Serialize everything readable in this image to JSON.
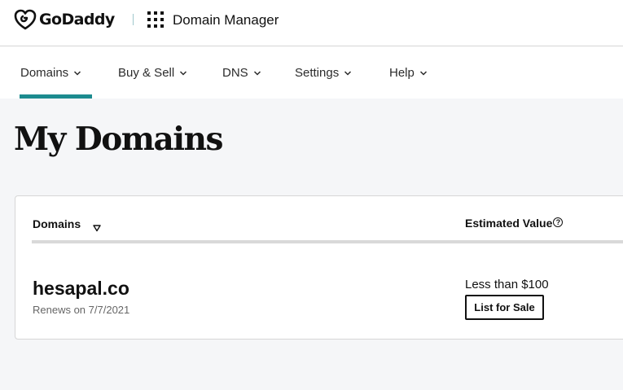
{
  "header": {
    "logo_text": "GoDaddy",
    "logo_icon": "godaddy-heart-icon",
    "apps_icon": "grid-icon",
    "app_title": "Domain Manager"
  },
  "nav": {
    "items": [
      {
        "label": "Domains",
        "active": true
      },
      {
        "label": "Buy & Sell",
        "active": false
      },
      {
        "label": "DNS",
        "active": false
      },
      {
        "label": "Settings",
        "active": false
      },
      {
        "label": "Help",
        "active": false
      }
    ],
    "accent_color": "#1c8b8f"
  },
  "main": {
    "title": "My Domains"
  },
  "table": {
    "columns": [
      {
        "label": "Domains",
        "sort_icon": "sort-down-icon"
      },
      {
        "label": "Estimated Value",
        "info_icon": "help-circle-icon"
      }
    ],
    "rows": [
      {
        "domain": "hesapal.co",
        "renews": "Renews on 7/7/2021",
        "estimated_value": "Less than $100",
        "action_label": "List for Sale"
      }
    ]
  }
}
